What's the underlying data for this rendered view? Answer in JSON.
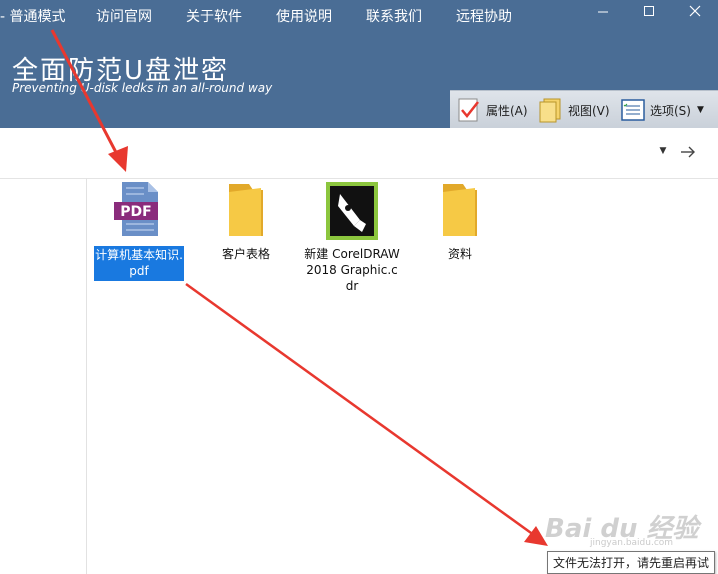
{
  "menubar": {
    "items": [
      "- 普通模式",
      "访问官网",
      "关于软件",
      "使用说明",
      "联系我们",
      "远程协助"
    ]
  },
  "app": {
    "title": "全面防范U盘泄密",
    "subtitle": "Preventing U-disk ledks in an all-round way"
  },
  "toolbar": {
    "properties_label": "属性(A)",
    "view_label": "视图(V)",
    "options_label": "选项(S)"
  },
  "files": [
    {
      "name": "计算机基本知识.pdf",
      "icon": "pdf-file-icon",
      "selected": true
    },
    {
      "name": "客户表格",
      "icon": "folder-icon",
      "selected": false
    },
    {
      "name": "新建 CorelDRAW 2018 Graphic.cdr",
      "icon": "coreldraw-file-icon",
      "selected": false
    },
    {
      "name": "资料",
      "icon": "folder-icon",
      "selected": false
    }
  ],
  "tooltip": {
    "text": "文件无法打开，请先重启再试"
  },
  "watermark": {
    "text": "Bai du 经验",
    "sub": "jingyan.baidu.com"
  },
  "colors": {
    "header": "#4a6d95",
    "selection": "#1979e0",
    "annotation_arrow": "#e8382f",
    "folder": "#f6c945"
  }
}
